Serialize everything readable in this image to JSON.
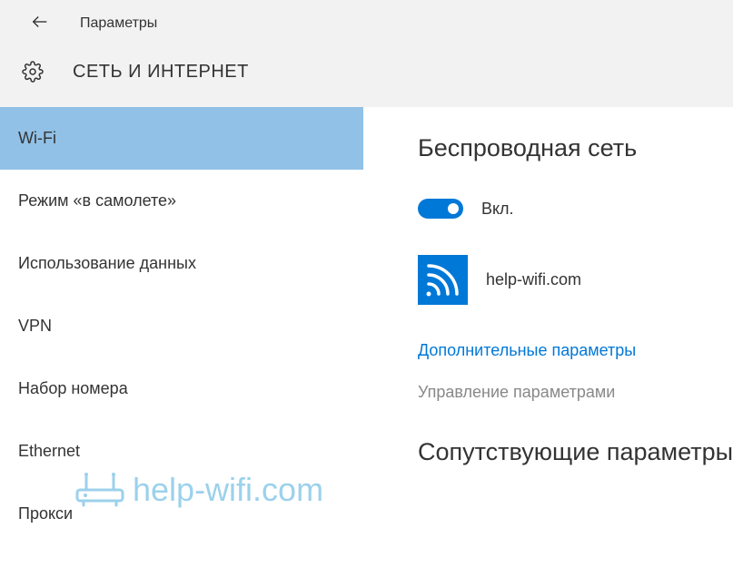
{
  "header": {
    "app_title": "Параметры",
    "section_title": "СЕТЬ И ИНТЕРНЕТ"
  },
  "sidebar": {
    "items": [
      {
        "label": "Wi-Fi",
        "selected": true
      },
      {
        "label": "Режим «в самолете»",
        "selected": false
      },
      {
        "label": "Использование данных",
        "selected": false
      },
      {
        "label": "VPN",
        "selected": false
      },
      {
        "label": "Набор номера",
        "selected": false
      },
      {
        "label": "Ethernet",
        "selected": false
      },
      {
        "label": "Прокси",
        "selected": false
      }
    ]
  },
  "content": {
    "heading": "Беспроводная сеть",
    "toggle_state": "on",
    "toggle_label": "Вкл.",
    "network_name": "help-wifi.com",
    "advanced_link": "Дополнительные параметры",
    "manage_text": "Управление параметрами",
    "related_heading": "Сопутствующие параметры"
  },
  "watermark": {
    "text": "help-wifi.com"
  }
}
